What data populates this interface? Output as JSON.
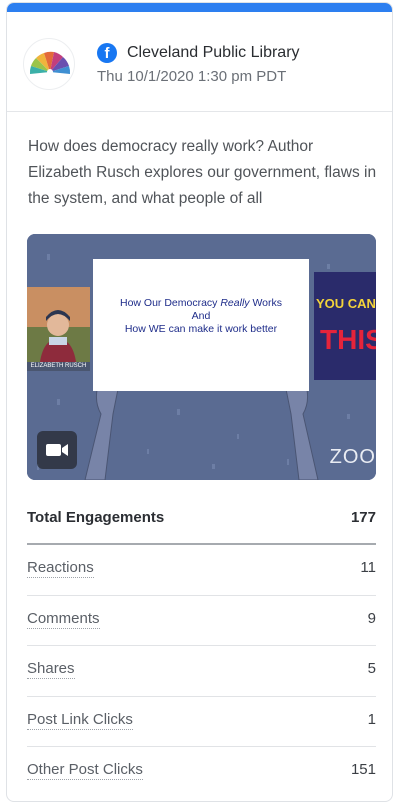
{
  "post": {
    "page_name": "Cleveland Public Library",
    "timestamp": "Thu 10/1/2020 1:30 pm PDT",
    "text": "How does democracy really work? Author Elizabeth Rusch explores our government, flaws in the system, and what people of all",
    "network_icon": "facebook-icon",
    "avatar_icon": "library-logo-icon"
  },
  "media": {
    "board_line1_a": "How Our Democracy ",
    "board_line1_em": "Really",
    "board_line1_b": " Works",
    "board_line2": "And",
    "board_line3": "How WE can make it work better",
    "webcam_label": "ELIZABETH RUSCH",
    "book_title": "YOU CAN",
    "book_word": "THIS",
    "zoom_mark": "ZOO",
    "video_icon": "video-camera-icon"
  },
  "metrics": [
    {
      "label": "Total Engagements",
      "value": "177"
    },
    {
      "label": "Reactions",
      "value": "11"
    },
    {
      "label": "Comments",
      "value": "9"
    },
    {
      "label": "Shares",
      "value": "5"
    },
    {
      "label": "Post Link Clicks",
      "value": "1"
    },
    {
      "label": "Other Post Clicks",
      "value": "151"
    }
  ],
  "colors": {
    "accent": "#2d7ff0",
    "facebook": "#1877f2"
  }
}
